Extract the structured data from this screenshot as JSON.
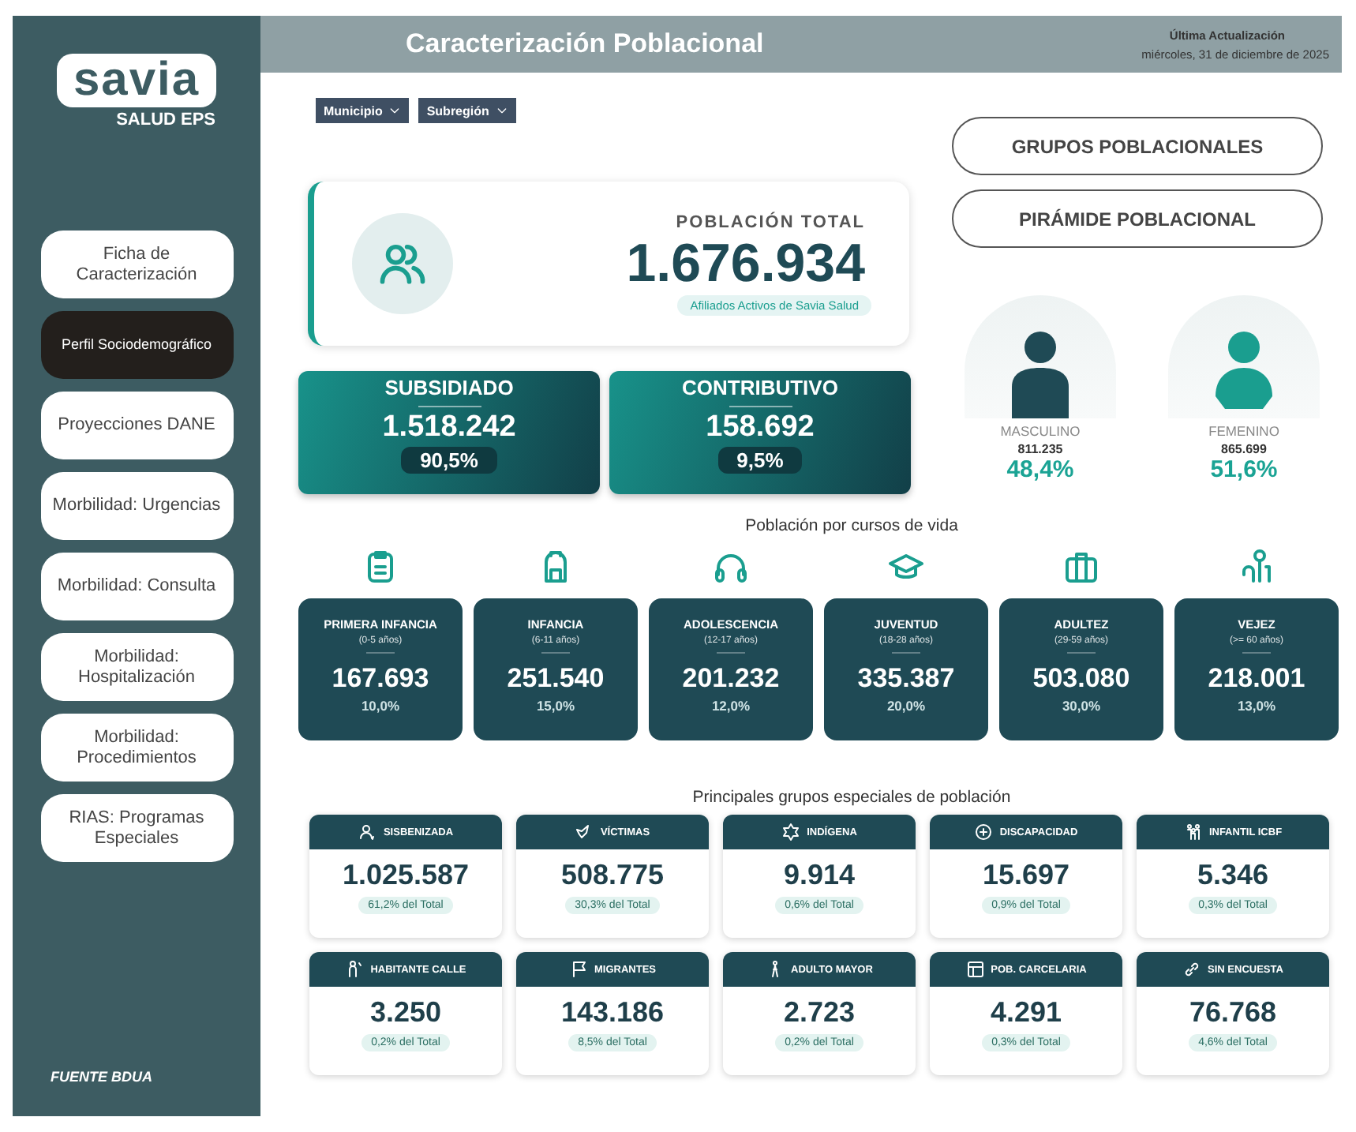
{
  "sidebar": {
    "logo": {
      "wordmark": "savia",
      "subtitle": "SALUD EPS"
    },
    "items": [
      {
        "label": "Ficha de Caracterización",
        "selected": false
      },
      {
        "label": "Perfil Sociodemográfico",
        "selected": true
      },
      {
        "label": "Proyecciones DANE",
        "selected": false
      },
      {
        "label": "Morbilidad: Urgencias",
        "selected": false
      },
      {
        "label": "Morbilidad: Consulta",
        "selected": false
      },
      {
        "label": "Morbilidad: Hospitalización",
        "selected": false
      },
      {
        "label": "Morbilidad: Procedimientos",
        "selected": false
      },
      {
        "label": "RIAS: Programas Especiales",
        "selected": false
      }
    ],
    "footer": "FUENTE BDUA"
  },
  "header": {
    "title": "Caracterización Poblacional",
    "update_label": "Última Actualización",
    "update_date": "miércoles, 31 de diciembre de 2025"
  },
  "filters": [
    {
      "label": "Municipio"
    },
    {
      "label": "Subregión"
    }
  ],
  "total": {
    "label": "POBLACIÓN TOTAL",
    "value": "1.676.934",
    "note": "Afiliados Activos de Savia Salud"
  },
  "regimes": [
    {
      "label": "SUBSIDIADO",
      "value": "1.518.242",
      "percent": "90,5%"
    },
    {
      "label": "CONTRIBUTIVO",
      "value": "158.692",
      "percent": "9,5%"
    }
  ],
  "nav_buttons": [
    "GRUPOS POBLACIONALES",
    "PIRÁMIDE POBLACIONAL"
  ],
  "genders": [
    {
      "label": "MASCULINO",
      "value": "811.235",
      "percent": "48,4%",
      "color": "#1f4a55"
    },
    {
      "label": "FEMENINO",
      "value": "865.699",
      "percent": "51,6%",
      "color": "#1a9e8f"
    }
  ],
  "life_stages": {
    "title": "Población por cursos de vida",
    "stages": [
      {
        "name": "PRIMERA INFANCIA",
        "range": "(0-5 años)",
        "value": "167.693",
        "percent": "10,0%"
      },
      {
        "name": "INFANCIA",
        "range": "(6-11 años)",
        "value": "251.540",
        "percent": "15,0%"
      },
      {
        "name": "ADOLESCENCIA",
        "range": "(12-17 años)",
        "value": "201.232",
        "percent": "12,0%"
      },
      {
        "name": "JUVENTUD",
        "range": "(18-28 años)",
        "value": "335.387",
        "percent": "20,0%"
      },
      {
        "name": "ADULTEZ",
        "range": "(29-59 años)",
        "value": "503.080",
        "percent": "30,0%"
      },
      {
        "name": "VEJEZ",
        "range": "(>= 60 años)",
        "value": "218.001",
        "percent": "13,0%"
      }
    ]
  },
  "special_groups": {
    "title": "Principales grupos especiales de población",
    "groups": [
      {
        "name": "SISBENIZADA",
        "value": "1.025.587",
        "share": "61,2% del Total"
      },
      {
        "name": "VÍCTIMAS",
        "value": "508.775",
        "share": "30,3% del Total"
      },
      {
        "name": "INDÍGENA",
        "value": "9.914",
        "share": "0,6% del Total"
      },
      {
        "name": "DISCAPACIDAD",
        "value": "15.697",
        "share": "0,9% del Total"
      },
      {
        "name": "INFANTIL ICBF",
        "value": "5.346",
        "share": "0,3% del Total"
      },
      {
        "name": "HABITANTE CALLE",
        "value": "3.250",
        "share": "0,2% del Total"
      },
      {
        "name": "MIGRANTES",
        "value": "143.186",
        "share": "8,5% del Total"
      },
      {
        "name": "ADULTO MAYOR",
        "value": "2.723",
        "share": "0,2% del Total"
      },
      {
        "name": "POB. CARCELARIA",
        "value": "4.291",
        "share": "0,3% del Total"
      },
      {
        "name": "SIN ENCUESTA",
        "value": "76.768",
        "share": "4,6% del Total"
      }
    ]
  }
}
